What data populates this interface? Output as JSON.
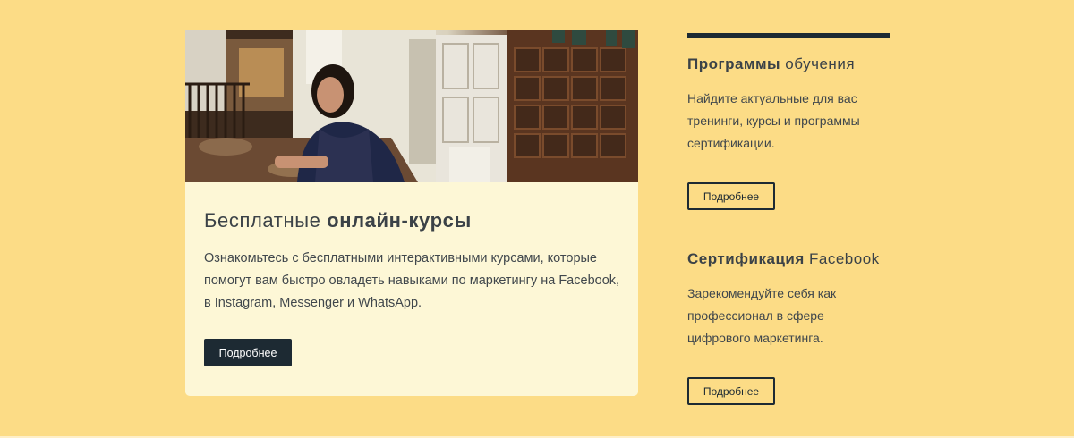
{
  "featured": {
    "photo_alt": "",
    "title_regular": "Бесплатные ",
    "title_bold": "онлайн-курсы",
    "description": "Ознакомьтесь с бесплатными интерактивными курсами, которые помогут вам быстро овладеть навыками по маркетингу на Facebook, в Instagram, Messenger и WhatsApp.",
    "button_label": "Подробнее"
  },
  "sidebar": {
    "programs": {
      "title_bold": "Программы",
      "title_regular": " обучения",
      "description": "Найдите актуальные для вас тренинги, курсы и программы сертификации.",
      "button_label": "Подробнее"
    },
    "certification": {
      "title_bold": "Сертификация",
      "title_regular": " Facebook",
      "description": "Зарекомендуйте себя как профессионал в сфере цифрового маркетинга.",
      "button_label": "Подробнее"
    }
  },
  "colors": {
    "page_background": "#fcdc86",
    "card_background": "#fdf7d6",
    "dark_accent": "#1d2a33",
    "text": "#3b4247"
  }
}
